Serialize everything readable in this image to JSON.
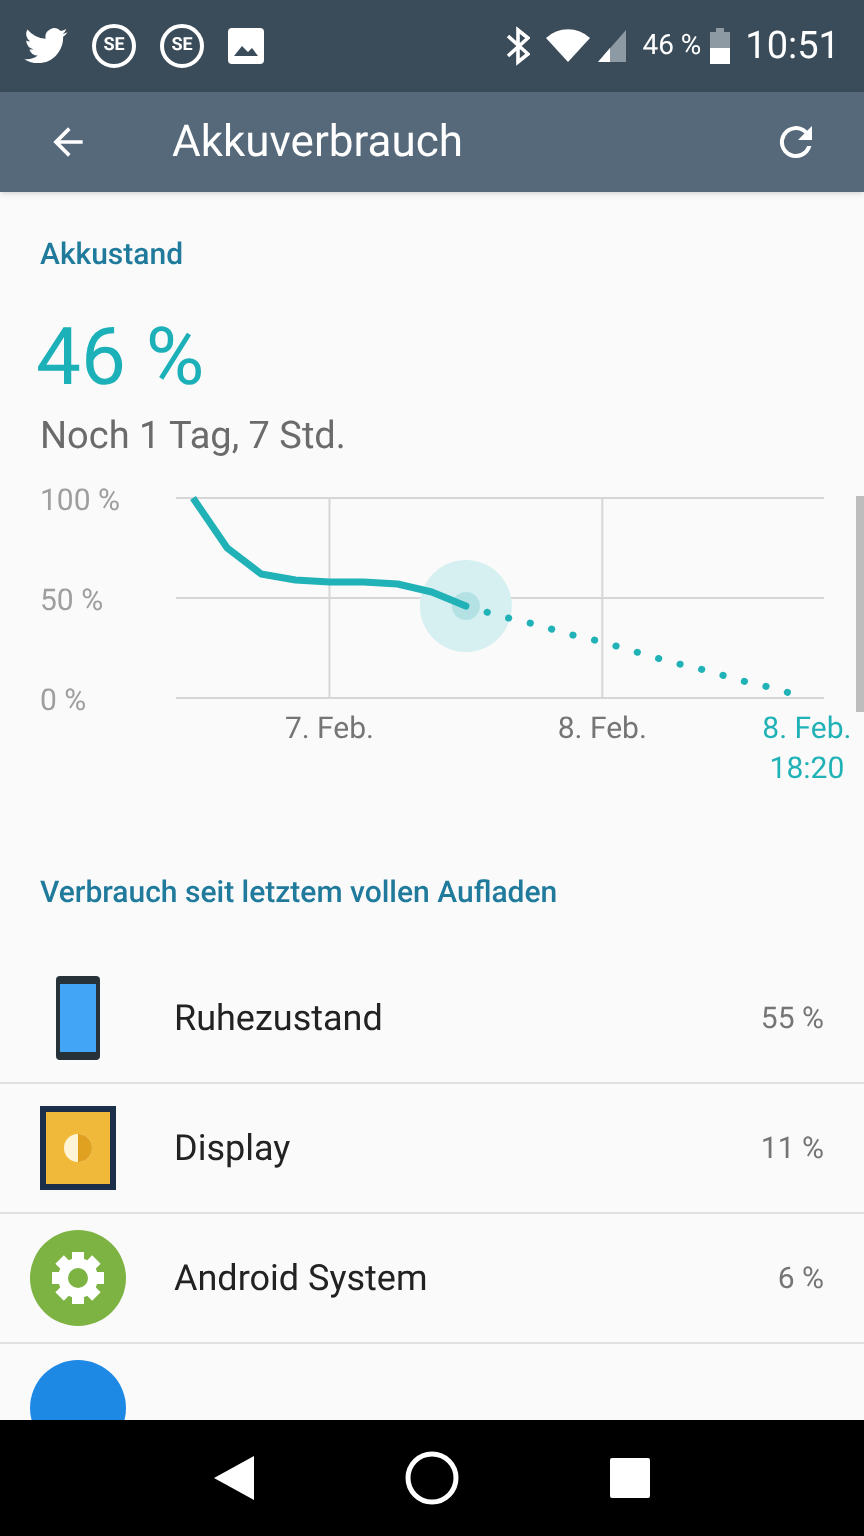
{
  "status_bar": {
    "app_badges": [
      "SE",
      "SE"
    ],
    "battery_text": "46 %",
    "time": "10:51"
  },
  "app_bar": {
    "title": "Akkuverbrauch"
  },
  "battery": {
    "heading": "Akkustand",
    "percent": "46 %",
    "remaining": "Noch 1 Tag, 7 Std.",
    "chart_data": {
      "type": "line",
      "categories": [
        null,
        null,
        null,
        null,
        "7. Feb.",
        null,
        null,
        null,
        null,
        null,
        null,
        null,
        "8. Feb.",
        null,
        null,
        null,
        null,
        null,
        "8. Feb. 18:20"
      ],
      "series": [
        {
          "color": "#20b2b6",
          "values": [
            100,
            75,
            62,
            59,
            58,
            58,
            57,
            53,
            46,
            null,
            null,
            null,
            null,
            null,
            null,
            null,
            null,
            null,
            null
          ]
        },
        {
          "color": "#20b2b6",
          "line_style": "dotted",
          "values": [
            null,
            null,
            null,
            null,
            null,
            null,
            null,
            null,
            46,
            41,
            37,
            32,
            28,
            23,
            18,
            14,
            9,
            5,
            0
          ]
        }
      ],
      "ylim": [
        0,
        100
      ],
      "grid": true,
      "yticks": [
        {
          "value": 0,
          "label": "0 %"
        },
        {
          "value": 50,
          "label": "50 %"
        },
        {
          "value": 100,
          "label": "100 %"
        }
      ]
    }
  },
  "usage": {
    "heading": "Verbrauch seit letztem vollen Aufladen",
    "items": [
      {
        "kind": "phone",
        "name": "Ruhezustand",
        "percent": "55 %"
      },
      {
        "kind": "display",
        "name": "Display",
        "percent": "11 %"
      },
      {
        "kind": "gear",
        "name": "Android System",
        "percent": "6 %"
      },
      {
        "kind": "partial"
      }
    ]
  }
}
